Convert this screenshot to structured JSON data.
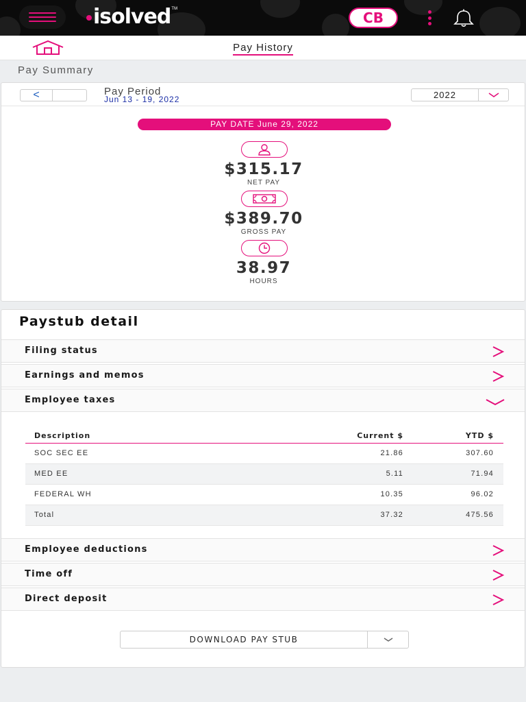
{
  "app": {
    "logo_text": "isolved",
    "user_initials": "CB",
    "accent_color": "#e40f7b",
    "icons": [
      "hamburger-menu-icon",
      "kebab-menu-icon",
      "bell-icon",
      "home-icon"
    ]
  },
  "header": {
    "title": "Pay History"
  },
  "summary": {
    "section_label": "Pay Summary",
    "period_label": "Pay Period",
    "period_dates": "Jun 13 - 19, 2022",
    "prev_symbol": "<",
    "year": "2022",
    "pay_date": "PAY DATE  June 29, 2022",
    "net_pay": {
      "value": "$315.17",
      "label": "NET PAY"
    },
    "gross_pay": {
      "value": "$389.70",
      "label": "GROSS PAY"
    },
    "hours": {
      "value": "38.97",
      "label": "HOURS"
    }
  },
  "detail": {
    "title": "Paystub detail",
    "sections": [
      {
        "label": "Filing status",
        "expanded": false
      },
      {
        "label": "Earnings and memos",
        "expanded": false
      },
      {
        "label": "Employee taxes",
        "expanded": true
      },
      {
        "label": "Employee deductions",
        "expanded": false
      },
      {
        "label": "Time off",
        "expanded": false
      },
      {
        "label": "Direct deposit",
        "expanded": false
      }
    ],
    "taxes": {
      "columns": [
        "Description",
        "Current $",
        "YTD $"
      ],
      "rows": [
        {
          "description": "SOC SEC EE",
          "current": "21.86",
          "ytd": "307.60"
        },
        {
          "description": "MED EE",
          "current": "5.11",
          "ytd": "71.94"
        },
        {
          "description": "FEDERAL WH",
          "current": "10.35",
          "ytd": "96.02"
        },
        {
          "description": "Total",
          "current": "37.32",
          "ytd": "475.56"
        }
      ]
    },
    "download_label": "DOWNLOAD PAY STUB"
  }
}
